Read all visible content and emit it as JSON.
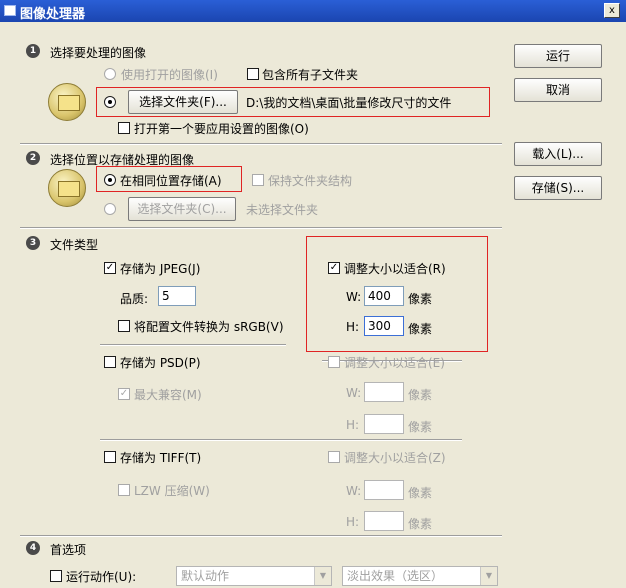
{
  "window": {
    "title": "图像处理器",
    "close": "x"
  },
  "buttons": {
    "run": "运行",
    "cancel": "取消",
    "load": "载入(L)...",
    "save": "存储(S)..."
  },
  "section1": {
    "num": "1",
    "heading": "选择要处理的图像",
    "use_open_images": "使用打开的图像(I)",
    "include_subfolders": "包含所有子文件夹",
    "select_folder_button": "选择文件夹(F)...",
    "folder_path": "D:\\我的文档\\桌面\\批量修改尺寸的文件",
    "open_first_image": "打开第一个要应用设置的图像(O)"
  },
  "section2": {
    "num": "2",
    "heading": "选择位置以存储处理的图像",
    "save_same_location": "在相同位置存储(A)",
    "keep_folder_structure": "保持文件夹结构",
    "select_folder_button": "选择文件夹(C)...",
    "no_folder_selected": "未选择文件夹"
  },
  "section3": {
    "num": "3",
    "heading": "文件类型",
    "jpeg": {
      "save_as": "存储为 JPEG(J)",
      "quality_label": "品质:",
      "quality_value": "5",
      "convert_srgb": "将配置文件转换为 sRGB(V)",
      "resize_to_fit": "调整大小以适合(R)",
      "w_label": "W:",
      "w_value": "400",
      "h_label": "H:",
      "h_value": "300",
      "unit": "像素"
    },
    "psd": {
      "save_as": "存储为 PSD(P)",
      "maximize_compat": "最大兼容(M)",
      "resize_to_fit": "调整大小以适合(E)",
      "w_label": "W:",
      "h_label": "H:",
      "unit": "像素"
    },
    "tiff": {
      "save_as": "存储为 TIFF(T)",
      "lzw": "LZW 压缩(W)",
      "resize_to_fit": "调整大小以适合(Z)",
      "w_label": "W:",
      "h_label": "H:",
      "unit": "像素"
    }
  },
  "section4": {
    "num": "4",
    "heading": "首选项",
    "run_action": "运行动作(U):",
    "action_set": "默认动作",
    "action": "淡出效果（选区）"
  }
}
